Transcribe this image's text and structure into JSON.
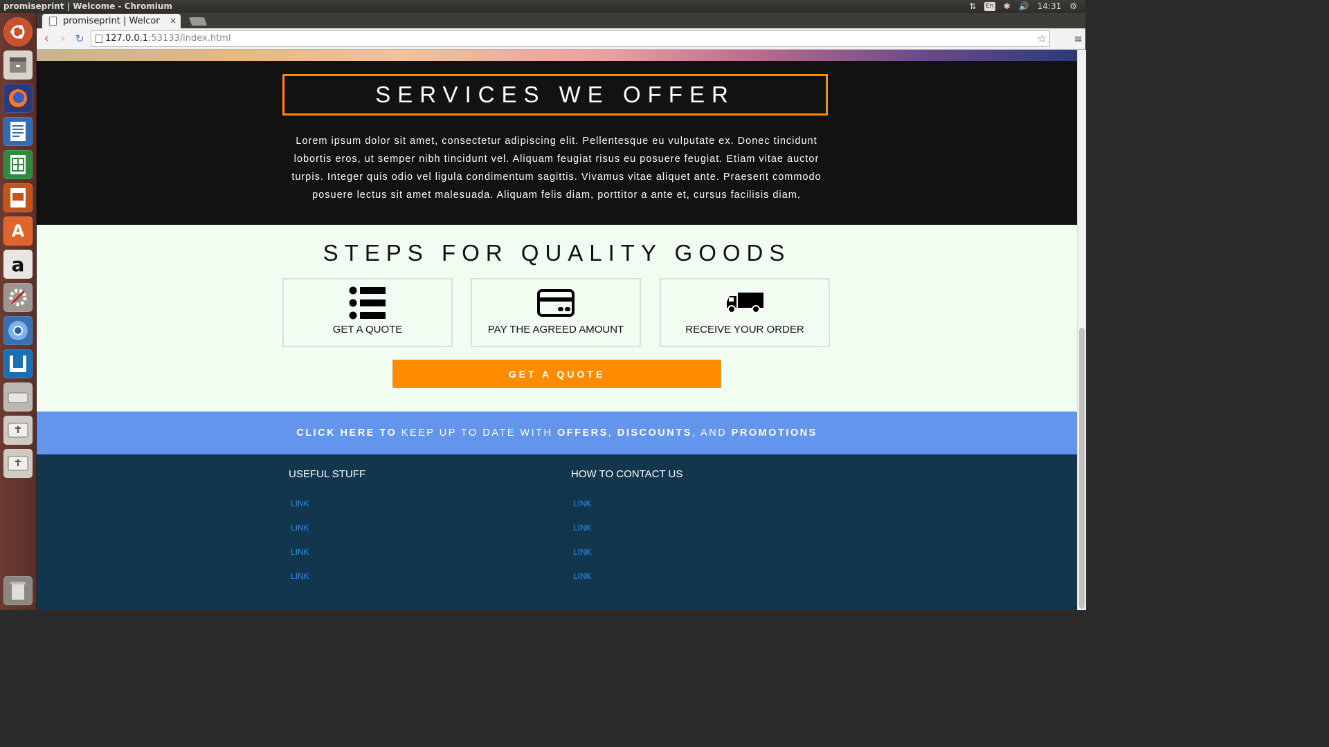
{
  "os": {
    "window_title": "promiseprint | Welcome - Chromium",
    "tray": {
      "keyboard": "En",
      "clock": "14:31"
    }
  },
  "browser": {
    "tab_title": "promiseprint | Welcome",
    "url_host": "127.0.0.1",
    "url_rest": ":53133/index.html"
  },
  "services": {
    "title": "SERVICES WE OFFER",
    "text": "Lorem ipsum dolor sit amet, consectetur adipiscing elit. Pellentesque eu vulputate ex. Donec tincidunt lobortis eros, ut semper nibh tincidunt vel. Aliquam feugiat risus eu posuere feugiat. Etiam vitae auctor turpis. Integer quis odio vel ligula condimentum sagittis. Vivamus vitae aliquet ante. Praesent commodo posuere lectus sit amet malesuada. Aliquam felis diam, porttitor a ante et, cursus facilisis diam."
  },
  "steps": {
    "title": "STEPS FOR QUALITY GOODS",
    "items": [
      {
        "label": "GET A QUOTE",
        "icon": "list-icon"
      },
      {
        "label": "PAY THE AGREED AMOUNT",
        "icon": "credit-card-icon"
      },
      {
        "label": "RECEIVE YOUR ORDER",
        "icon": "truck-icon"
      }
    ],
    "button": "GET A QUOTE"
  },
  "promo": {
    "part1": "CLICK HERE TO",
    "part2": " KEEP UP TO DATE WITH ",
    "part3": "OFFERS",
    "part4": ", ",
    "part5": "DISCOUNTS",
    "part6": ", AND ",
    "part7": "PROMOTIONS"
  },
  "footer": {
    "col1": {
      "heading": "USEFUL STUFF",
      "links": [
        "LINK",
        "LINK",
        "LINK",
        "LINK"
      ]
    },
    "col2": {
      "heading": "HOW TO CONTACT US",
      "links": [
        "LINK",
        "LINK",
        "LINK",
        "LINK"
      ]
    }
  },
  "colors": {
    "accent_orange": "#ff8c00",
    "promo_blue": "#6495ed",
    "footer_navy": "#12364d",
    "steps_bg": "#f0fdf0",
    "link_blue": "#1e90ff"
  }
}
